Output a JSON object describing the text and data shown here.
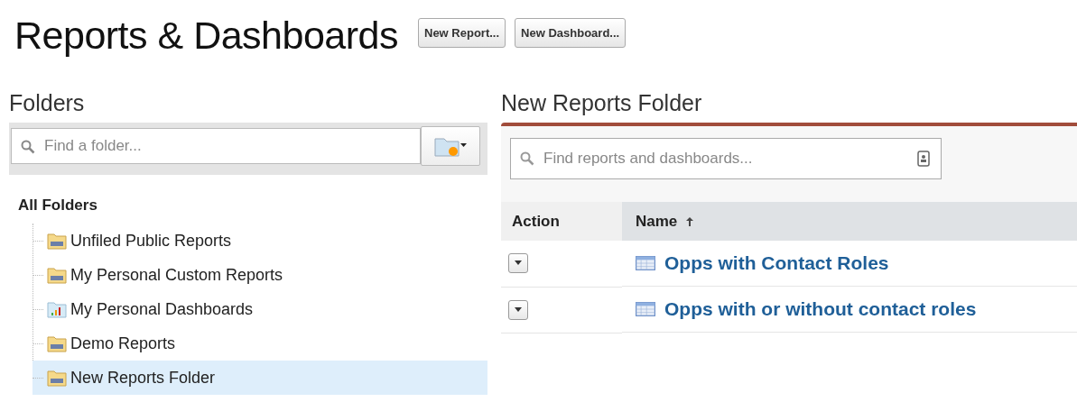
{
  "page": {
    "title": "Reports & Dashboards",
    "buttons": [
      "New Report...",
      "New Dashboard..."
    ]
  },
  "folders": {
    "heading": "Folders",
    "search": {
      "placeholder": "Find a folder..."
    },
    "root": "All Folders",
    "items": [
      {
        "label": "Unfiled Public Reports",
        "kind": "report",
        "selected": false
      },
      {
        "label": "My Personal Custom Reports",
        "kind": "report",
        "selected": false
      },
      {
        "label": "My Personal Dashboards",
        "kind": "dashboard",
        "selected": false
      },
      {
        "label": "Demo Reports",
        "kind": "report",
        "selected": false
      },
      {
        "label": "New Reports Folder",
        "kind": "report",
        "selected": true
      }
    ]
  },
  "main": {
    "heading": "New Reports Folder",
    "search": {
      "placeholder": "Find reports and dashboards..."
    },
    "columns": [
      {
        "label": "Action"
      },
      {
        "label": "Name",
        "sorted": true
      }
    ],
    "rows": [
      {
        "name": "Opps with Contact Roles"
      },
      {
        "name": "Opps with or without contact roles"
      }
    ]
  }
}
